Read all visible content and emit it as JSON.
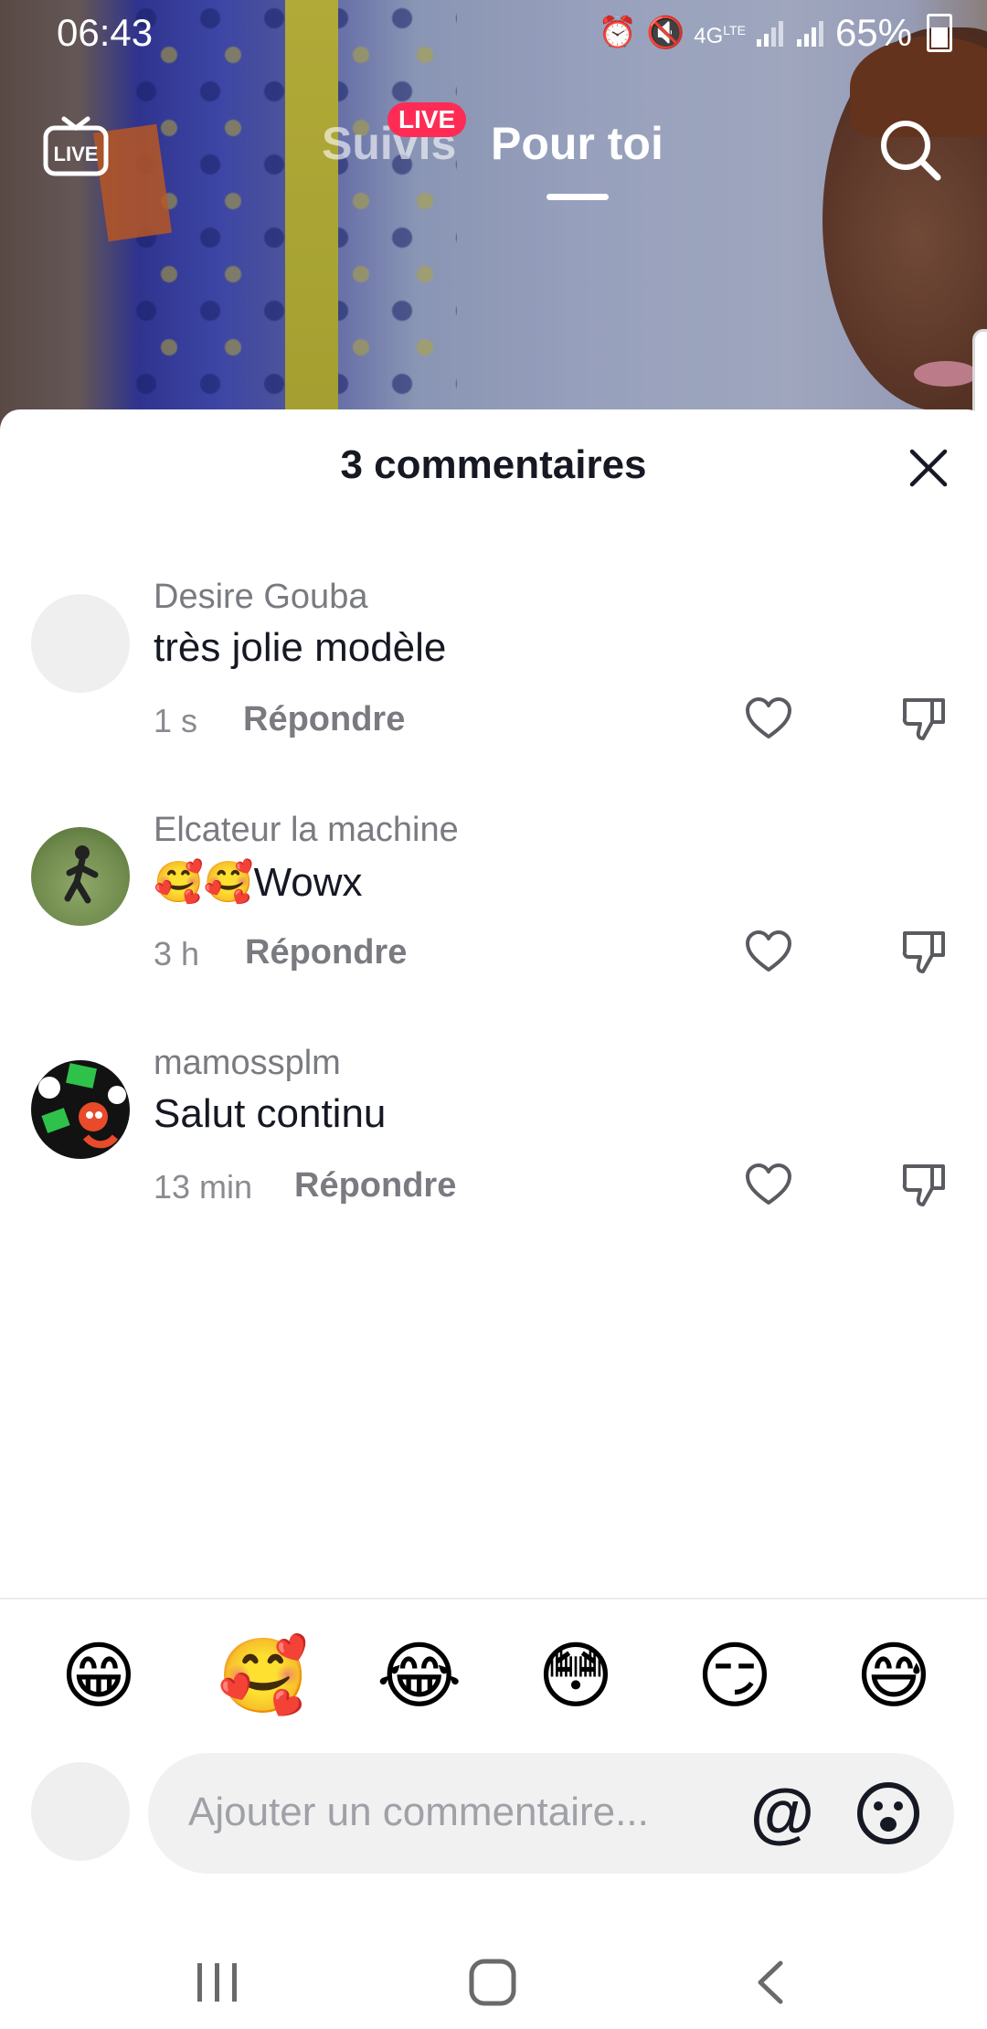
{
  "status_bar": {
    "time": "06:43",
    "network": "4G",
    "network_sub": "LTE",
    "battery": "65%"
  },
  "top_nav": {
    "following_label": "Suivis",
    "live_badge": "LIVE",
    "for_you_label": "Pour toi",
    "live_icon_text": "LIVE"
  },
  "comments_sheet": {
    "title": "3 commentaires",
    "comments": [
      {
        "username": "Desire Gouba",
        "text": "très jolie modèle",
        "time": "1 s",
        "reply_label": "Répondre"
      },
      {
        "username": "Elcateur la machine",
        "text": "🥰🥰Wowx",
        "time": "3 h",
        "reply_label": "Répondre"
      },
      {
        "username": "mamossplm",
        "text": "Salut continu",
        "time": "13 min",
        "reply_label": "Répondre"
      }
    ]
  },
  "emoji_bar": [
    "😁",
    "🥰",
    "😂",
    "😳",
    "😏",
    "😅"
  ],
  "input": {
    "placeholder": "Ajouter un commentaire...",
    "mention_symbol": "@"
  },
  "colors": {
    "accent": "#fe2c55",
    "text_primary": "#161823",
    "text_secondary": "#7a7b81",
    "input_bg": "#f1f1f2"
  }
}
